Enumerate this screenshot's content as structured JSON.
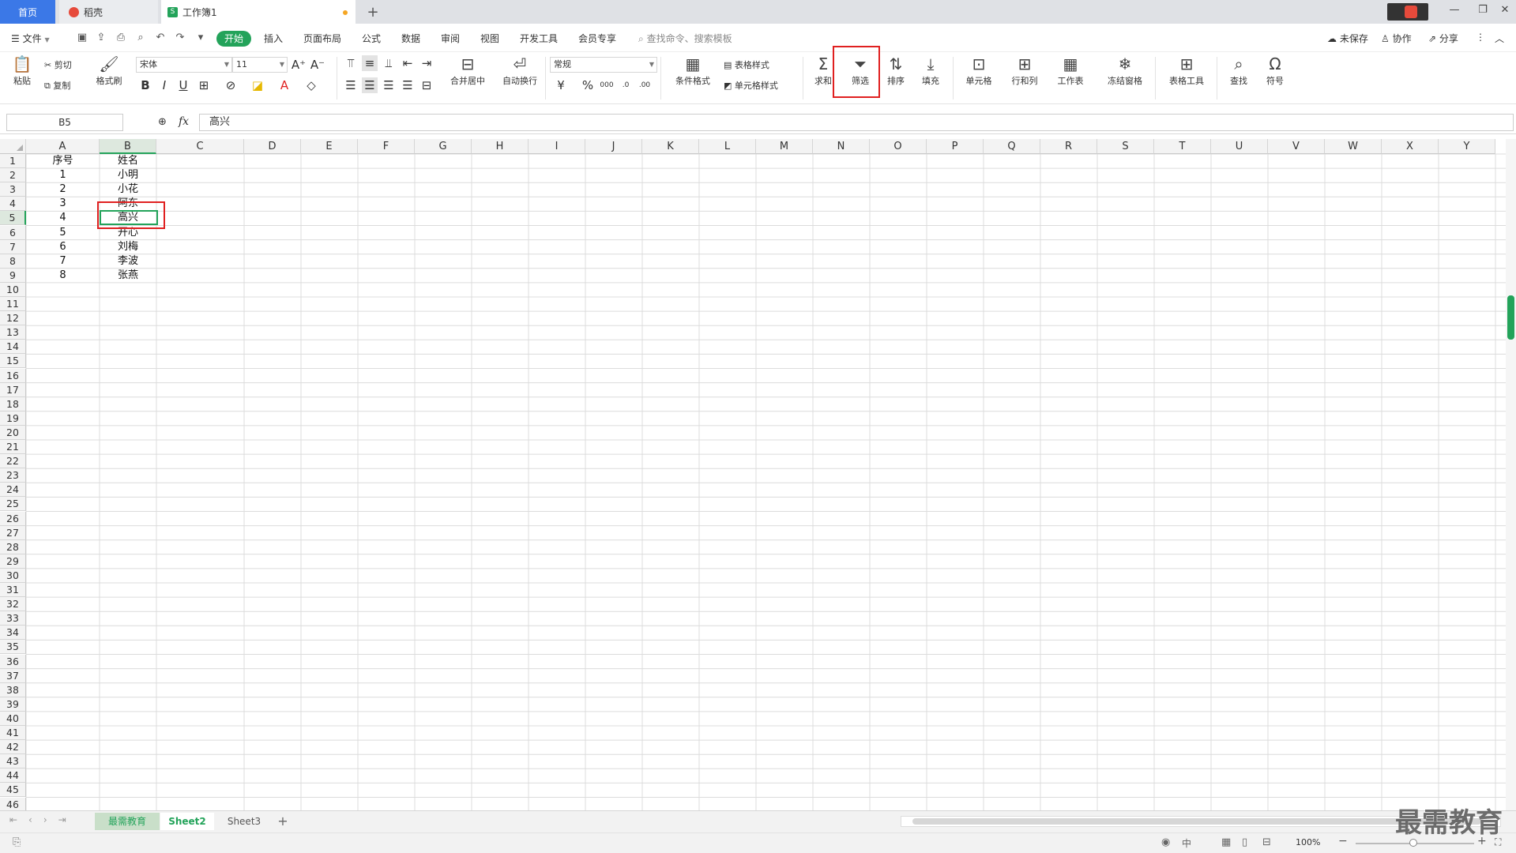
{
  "tabs": {
    "home": "首页",
    "daoke": "稻壳",
    "book": "工作簿1",
    "add": "+"
  },
  "menubar": {
    "file": "文件",
    "items": [
      "开始",
      "插入",
      "页面布局",
      "公式",
      "数据",
      "审阅",
      "视图",
      "开发工具",
      "会员专享"
    ],
    "search": "查找命令、搜索模板",
    "unsaved": "未保存",
    "collab": "协作",
    "share": "分享"
  },
  "ribbon": {
    "paste": "粘贴",
    "cut": "剪切",
    "copy": "复制",
    "format_painter": "格式刷",
    "font_name": "宋体",
    "font_size": "11",
    "merge_center": "合并居中",
    "wrap_text": "自动换行",
    "number_format": "常规",
    "cond_format": "条件格式",
    "table_style": "表格样式",
    "cell_style": "单元格样式",
    "sum": "求和",
    "filter": "筛选",
    "sort": "排序",
    "fill": "填充",
    "cell": "单元格",
    "row_col": "行和列",
    "worksheet": "工作表",
    "freeze": "冻结窗格",
    "table_tools": "表格工具",
    "find": "查找",
    "symbol": "符号"
  },
  "formula_bar": {
    "name_box": "B5",
    "fx": "fx",
    "value": "高兴"
  },
  "columns": [
    "A",
    "B",
    "C",
    "D",
    "E",
    "F",
    "G",
    "H",
    "I",
    "J",
    "K",
    "L",
    "M",
    "N",
    "O",
    "P",
    "Q",
    "R",
    "S",
    "T",
    "U",
    "V",
    "W",
    "X",
    "Y"
  ],
  "table": {
    "headers": [
      "序号",
      "姓名"
    ],
    "rows": [
      [
        "1",
        "小明"
      ],
      [
        "2",
        "小花"
      ],
      [
        "3",
        "阿东"
      ],
      [
        "4",
        "高兴"
      ],
      [
        "5",
        "开心"
      ],
      [
        "6",
        "刘梅"
      ],
      [
        "7",
        "李波"
      ],
      [
        "8",
        "张燕"
      ]
    ]
  },
  "row_count": 46,
  "sheets": [
    "最需教育",
    "Sheet2",
    "Sheet3"
  ],
  "active_sheet": "Sheet2",
  "status": {
    "zoom": "100%"
  },
  "watermark": "最需教育",
  "colors": {
    "accent": "#23a35a",
    "highlight": "#e02020",
    "tab_blue": "#3b78e7"
  }
}
